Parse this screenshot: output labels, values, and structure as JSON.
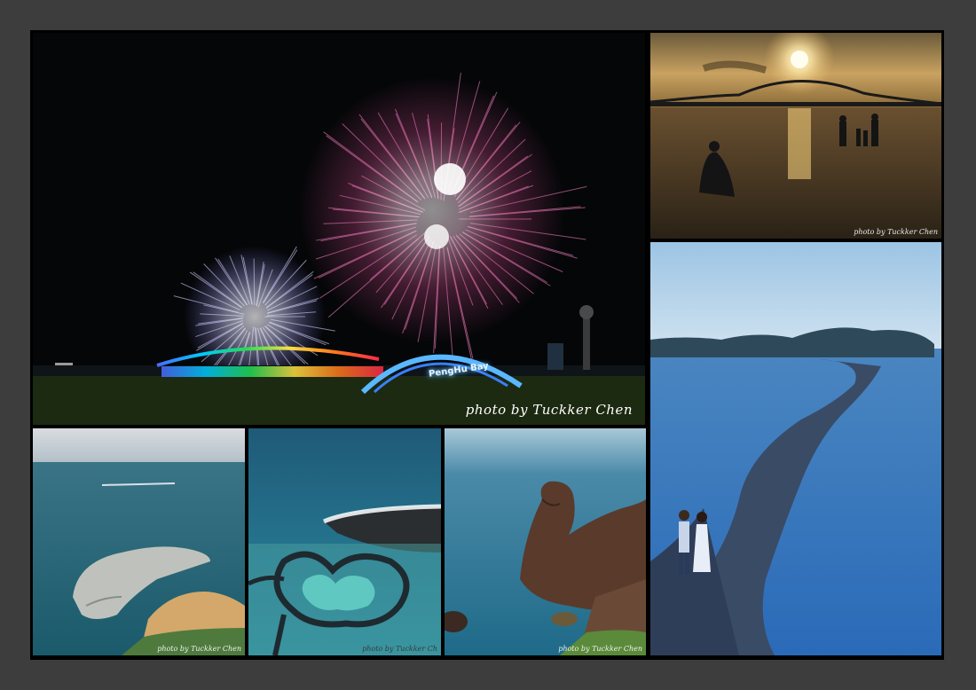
{
  "collage": {
    "background_color": "#3d3d3d",
    "frame_color": "#000000"
  },
  "photos": {
    "fireworks": {
      "scene": "fireworks-over-rainbow-bridge",
      "sign_text": "PengHu Bay",
      "credit": "photo by Tuckker Chen"
    },
    "sunset_bridge": {
      "scene": "sunset-bridge-silhouettes",
      "credit": "photo by Tuckker Chen"
    },
    "sandbar": {
      "scene": "couple-on-pebble-sandbar"
    },
    "coast_rock": {
      "scene": "coastal-rock-platform",
      "credit": "photo by Tuckker Chen"
    },
    "twin_hearts": {
      "scene": "twin-hearts-stone-weir",
      "credit": "photo by Tuckker Ch"
    },
    "sea_stack": {
      "scene": "basalt-sea-stack",
      "credit": "photo by Tuckker Chen"
    }
  }
}
